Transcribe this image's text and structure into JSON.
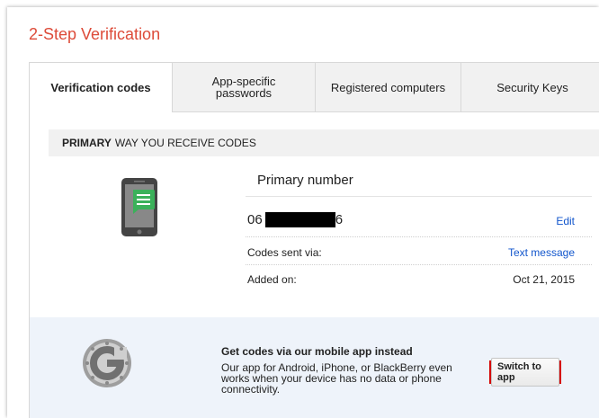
{
  "page": {
    "title": "2-Step Verification"
  },
  "tabs": [
    {
      "label": "Verification codes",
      "active": true
    },
    {
      "label": "App-specific passwords",
      "active": false
    },
    {
      "label": "Registered computers",
      "active": false
    },
    {
      "label": "Security Keys",
      "active": false
    }
  ],
  "primary": {
    "section_bold": "PRIMARY",
    "section_rest": "WAY YOU RECEIVE CODES",
    "heading": "Primary number",
    "number_prefix": "06",
    "number_suffix": "6",
    "edit_label": "Edit",
    "codes_label": "Codes sent via:",
    "codes_value": "Text message",
    "added_label": "Added on:",
    "added_value": "Oct 21, 2015"
  },
  "app_promo": {
    "title": "Get codes via our mobile app instead",
    "description": "Our app for Android, iPhone, or BlackBerry even works when your device has no data or phone connectivity.",
    "button_label": "Switch to app"
  },
  "icons": {
    "phone": "phone-message-icon",
    "google": "google-authenticator-icon"
  },
  "colors": {
    "title": "#dd4b39",
    "link": "#1155cc",
    "promo_bg": "#eef3fa",
    "highlight": "#d40000",
    "phone_screen": "#3bb15a"
  }
}
